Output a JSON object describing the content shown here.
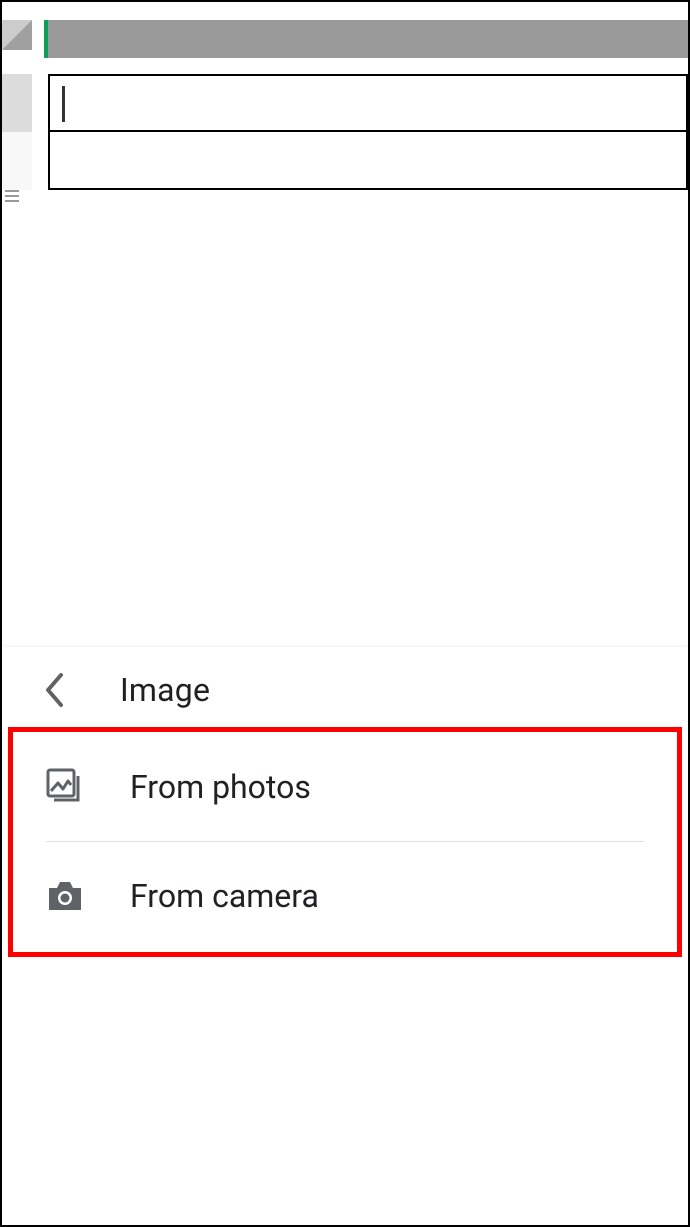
{
  "panel": {
    "title": "Image",
    "options": [
      {
        "label": "From photos",
        "icon": "photos-icon"
      },
      {
        "label": "From camera",
        "icon": "camera-icon"
      }
    ]
  }
}
